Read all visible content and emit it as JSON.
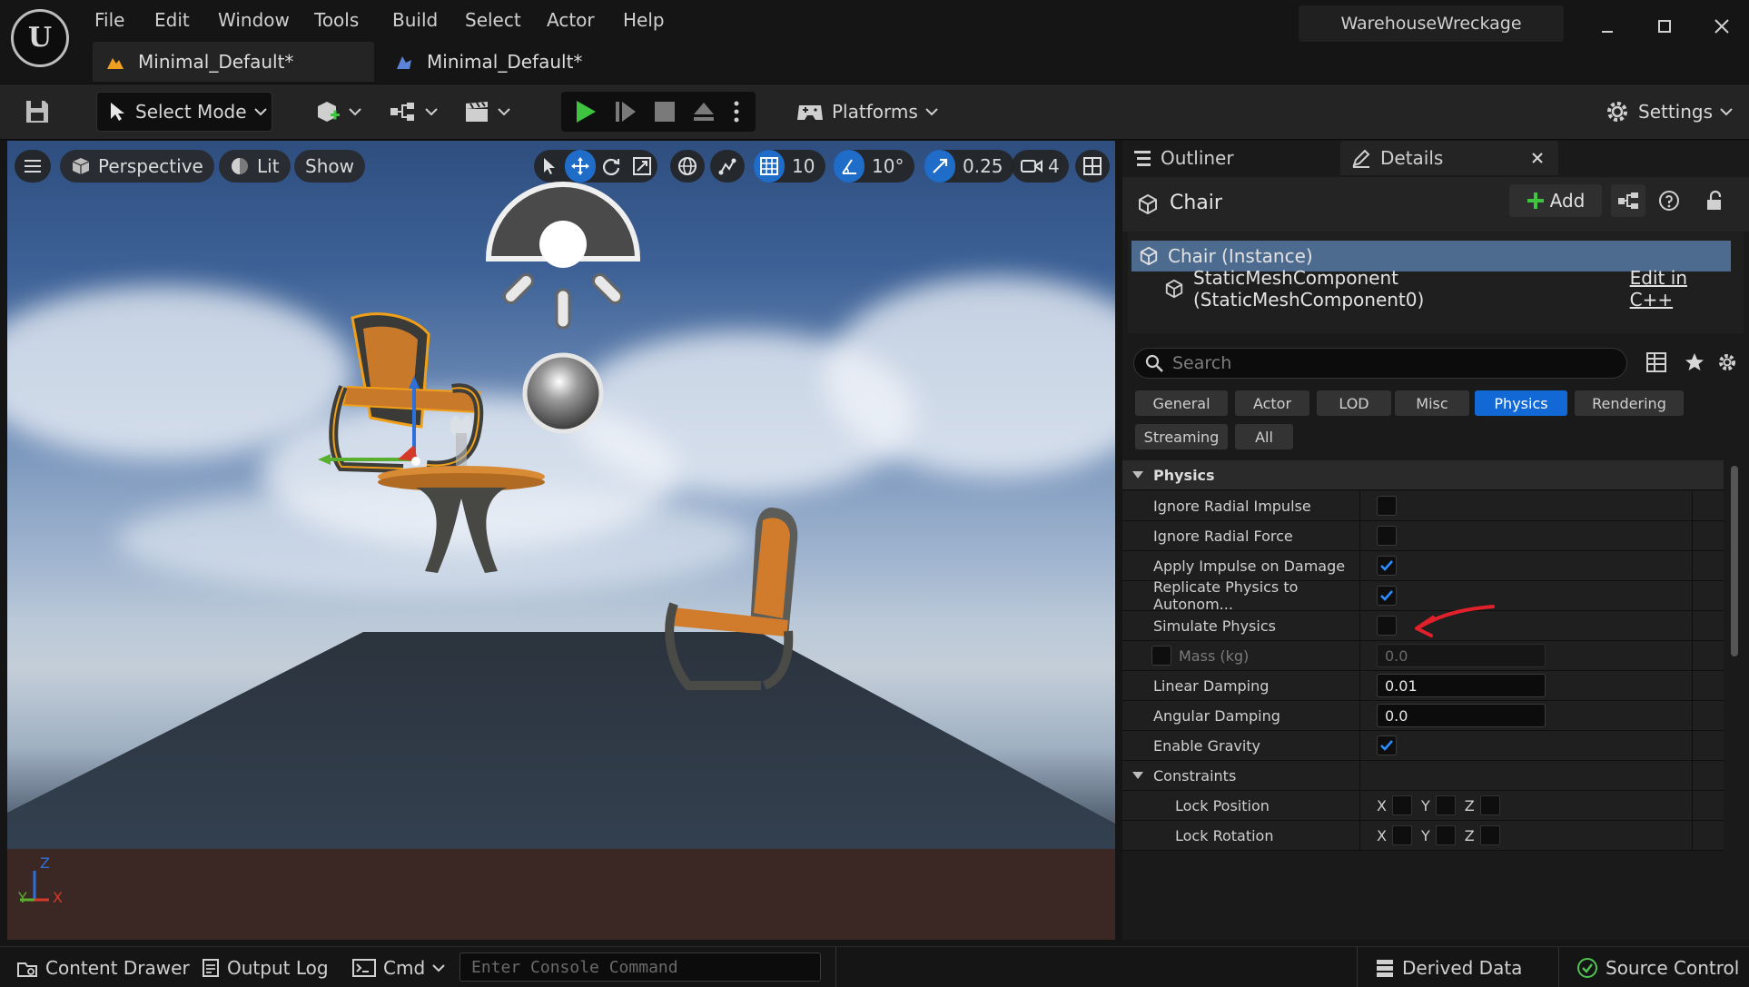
{
  "app": {
    "project_name": "WarehouseWreckage",
    "menu": [
      "File",
      "Edit",
      "Window",
      "Tools",
      "Build",
      "Select",
      "Actor",
      "Help"
    ],
    "tabs": [
      {
        "label": "Minimal_Default*",
        "active": true
      },
      {
        "label": "Minimal_Default*",
        "active": false
      }
    ]
  },
  "toolbar": {
    "select_mode": "Select Mode",
    "platforms": "Platforms",
    "settings": "Settings"
  },
  "viewport": {
    "perspective": "Perspective",
    "lit": "Lit",
    "show": "Show",
    "grid_snap": "10",
    "rotate_snap": "10°",
    "scale_snap": "0.25",
    "camera_speed": "4",
    "axis": {
      "z": "Z",
      "y": "Y",
      "x": "X"
    }
  },
  "panel": {
    "outliner_tab": "Outliner",
    "details_tab": "Details",
    "actor_name": "Chair",
    "add_label": "Add",
    "components": [
      {
        "label": "Chair (Instance)",
        "selected": true
      },
      {
        "label": "StaticMeshComponent (StaticMeshComponent0)",
        "selected": false
      }
    ],
    "edit_cpp": "Edit in C++",
    "search_placeholder": "Search",
    "filters": [
      "General",
      "Actor",
      "LOD",
      "Misc",
      "Physics",
      "Rendering",
      "Streaming",
      "All"
    ],
    "active_filter": "Physics",
    "physics_category": "Physics",
    "properties": {
      "ignore_radial_impulse": {
        "label": "Ignore Radial Impulse",
        "checked": false
      },
      "ignore_radial_force": {
        "label": "Ignore Radial Force",
        "checked": false
      },
      "apply_impulse_on_damage": {
        "label": "Apply Impulse on Damage",
        "checked": true
      },
      "replicate_physics": {
        "label": "Replicate Physics to Autonom...",
        "checked": true
      },
      "simulate_physics": {
        "label": "Simulate Physics",
        "checked": false
      },
      "mass": {
        "label": "Mass (kg)",
        "value": "0.0"
      },
      "linear_damping": {
        "label": "Linear Damping",
        "value": "0.01"
      },
      "angular_damping": {
        "label": "Angular Damping",
        "value": "0.0"
      },
      "enable_gravity": {
        "label": "Enable Gravity",
        "checked": true
      }
    },
    "constraints_category": "Constraints",
    "lock_position": "Lock Position",
    "lock_rotation": "Lock Rotation",
    "xyz": {
      "x": "X",
      "y": "Y",
      "z": "Z"
    }
  },
  "statusbar": {
    "content_drawer": "Content Drawer",
    "output_log": "Output Log",
    "cmd": "Cmd",
    "console_placeholder": "Enter Console Command",
    "derived_data": "Derived Data",
    "source_control": "Source Control"
  },
  "colors": {
    "accent": "#1269d6",
    "selection": "#4d6b8f",
    "play_green": "#3ec43e",
    "annotation_red": "#e0202a"
  }
}
